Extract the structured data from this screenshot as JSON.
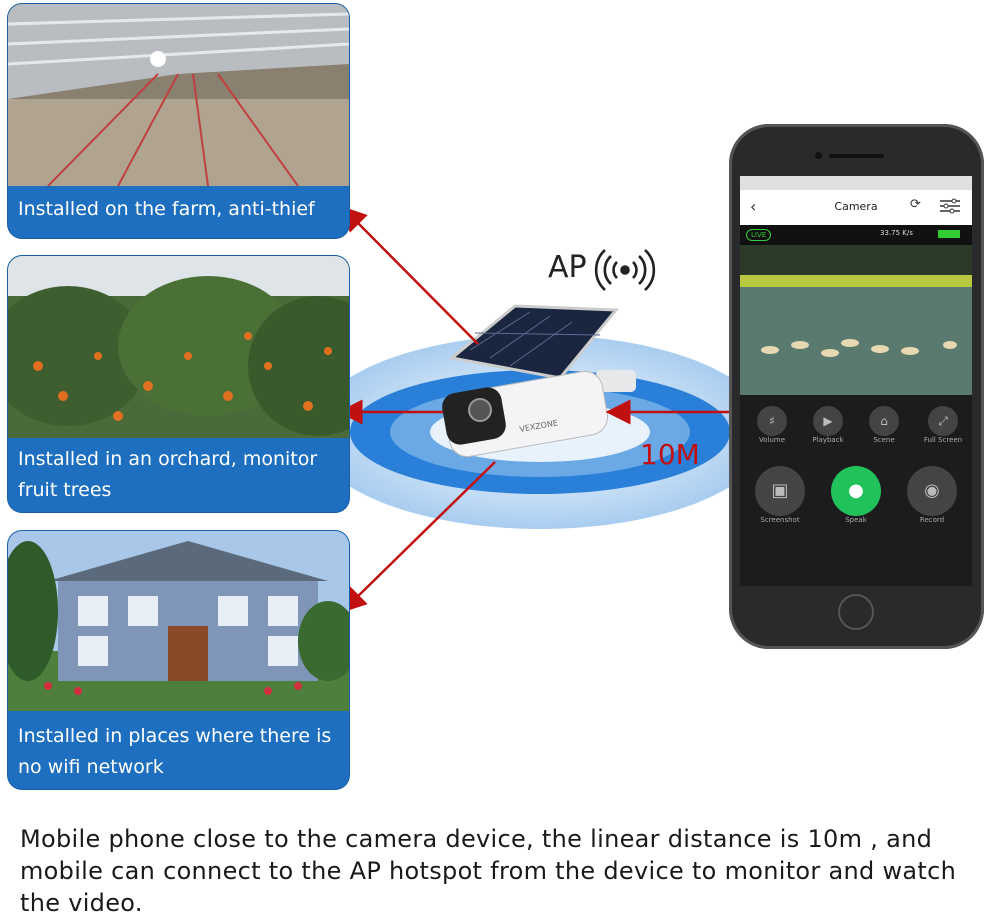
{
  "cards": [
    {
      "caption": "Installed on the farm, anti-thief"
    },
    {
      "caption": "Installed in an orchard, monitor fruit trees"
    },
    {
      "caption": "Installed in places where there is no wifi network"
    }
  ],
  "diagram": {
    "ap_label": "AP",
    "distance_label": "10M",
    "camera_brand": "VEXZONE"
  },
  "phone": {
    "app_title": "Camera",
    "live_badge": "LIVE",
    "speed": "33.75 K/s",
    "controls_row1": [
      "Volume",
      "Playback",
      "Scene",
      "Full Screen"
    ],
    "controls_row2": [
      "Screenshot",
      "Speak",
      "Record"
    ]
  },
  "caption": "Mobile phone close to the camera device, the linear distance is 10m , and mobile can connect to the AP hotspot from the device to monitor and watch the video.",
  "colors": {
    "card_blue": "#1f6fc0",
    "arrow_red": "#c01010",
    "speak_green": "#22c25a",
    "ring_blue": "#2a7fd8"
  }
}
